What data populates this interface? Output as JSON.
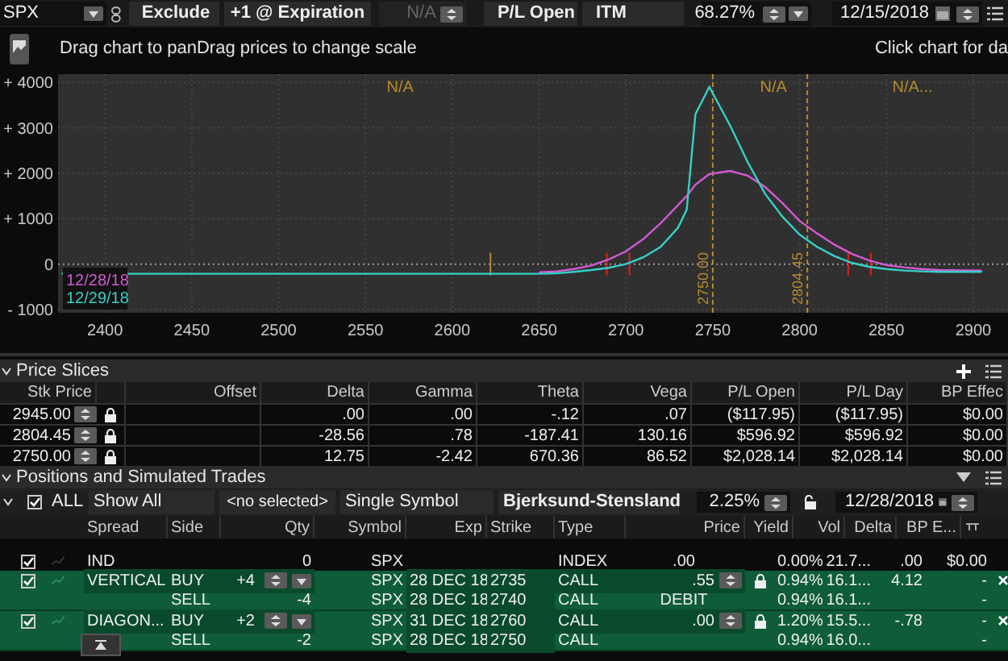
{
  "toolbar": {
    "symbol": "SPX",
    "exclude": "Exclude",
    "step": "+1 @ Expiration",
    "offset_field": "N/A",
    "pl_mode": "P/L Open",
    "moneyness": "ITM",
    "volatility": "68.27%",
    "date": "12/15/2018"
  },
  "hint_bar": {
    "left": "Drag chart to panDrag prices to change scale",
    "right": "Click chart for da"
  },
  "chart": {
    "zone_labels": [
      "N/A",
      "N/A",
      "N/A..."
    ],
    "chart_data": {
      "type": "line",
      "grid": true,
      "xlim": [
        2373,
        2920
      ],
      "ylim": [
        -1070,
        4180
      ],
      "xticks": [
        2400,
        2450,
        2500,
        2550,
        2600,
        2650,
        2700,
        2750,
        2800,
        2850,
        2900
      ],
      "yticks": [
        {
          "value": 4000,
          "label": "+ 4000"
        },
        {
          "value": 3000,
          "label": "+ 3000"
        },
        {
          "value": 2000,
          "label": "+ 2000"
        },
        {
          "value": 1000,
          "label": "+ 1000"
        },
        {
          "value": 0,
          "label": "0"
        },
        {
          "value": -1000,
          "label": "- 1000"
        }
      ],
      "x": [
        2375,
        2650,
        2660,
        2670,
        2680,
        2690,
        2700,
        2710,
        2720,
        2730,
        2735,
        2740,
        2748,
        2760,
        2770,
        2780,
        2790,
        2800,
        2810,
        2820,
        2830,
        2840,
        2850,
        2860,
        2870,
        2880,
        2905
      ],
      "series": [
        {
          "name": "12/28/18",
          "color": "#d25ad2",
          "values": [
            null,
            -180,
            -160,
            -110,
            -30,
            100,
            280,
            550,
            900,
            1300,
            1500,
            1750,
            1980,
            2050,
            1950,
            1700,
            1350,
            950,
            680,
            430,
            230,
            80,
            -20,
            -70,
            -110,
            -130,
            -140
          ]
        },
        {
          "name": "12/29/18",
          "color": "#35d0c8",
          "values": [
            -210,
            -210,
            -200,
            -170,
            -130,
            -80,
            0,
            150,
            380,
            800,
            1200,
            3300,
            3900,
            3050,
            2250,
            1550,
            1050,
            650,
            380,
            180,
            30,
            -60,
            -110,
            -140,
            -160,
            -170,
            -170
          ]
        }
      ],
      "ref_lines": [
        {
          "axis": "y",
          "value": 0,
          "color": "#999999"
        },
        {
          "axis": "x",
          "value": 2750,
          "label": "2750.00",
          "color": "#b88a2a"
        },
        {
          "axis": "x",
          "value": 2804.45,
          "label": "2804.45",
          "color": "#b88a2a"
        }
      ]
    }
  },
  "price_slices": {
    "title": "Price Slices",
    "columns": [
      "Stk Price",
      "Offset",
      "Delta",
      "Gamma",
      "Theta",
      "Vega",
      "P/L Open",
      "P/L Day",
      "BP Effec"
    ],
    "rows": [
      {
        "locked": true,
        "cells": [
          "2945.00",
          "",
          ".00",
          ".00",
          "-.12",
          ".07",
          "($117.95)",
          "($117.95)",
          "$0.00"
        ]
      },
      {
        "locked": true,
        "cells": [
          "2804.45",
          "",
          "-28.56",
          ".78",
          "-187.41",
          "130.16",
          "$596.92",
          "$596.92",
          "$0.00"
        ]
      },
      {
        "locked": true,
        "cells": [
          "2750.00",
          "",
          "12.75",
          "-2.42",
          "670.36",
          "86.52",
          "$2,028.14",
          "$2,028.14",
          "$0.00"
        ]
      }
    ]
  },
  "positions": {
    "title": "Positions and Simulated Trades",
    "filters": {
      "all_checked": true,
      "all": "ALL",
      "show": "Show All",
      "selection": "<no selected>",
      "mode": "Single Symbol",
      "model": "Bjerksund-Stensland",
      "rate": "2.25%",
      "date": "12/28/2018"
    },
    "columns": [
      "Spread",
      "Side",
      "Qty",
      "Symbol",
      "Exp",
      "Strike",
      "Type",
      "Price",
      "Yield",
      "Vol",
      "Delta",
      "BP E..."
    ],
    "rows": [
      {
        "simulated": false,
        "checked": true,
        "spread": "IND",
        "legs": [
          {
            "qty": "0",
            "symbol": "SPX",
            "type": "INDEX",
            "price": ".00",
            "locked": false,
            "yield": "0.00%",
            "vol": "21.7...",
            "delta": ".00",
            "bp": "$0.00"
          }
        ]
      },
      {
        "simulated": true,
        "checked": true,
        "spread": "VERTICAL",
        "legs": [
          {
            "side": "BUY",
            "qty": "+4",
            "symbol": "SPX",
            "exp": "28 DEC 18",
            "strike": "2735",
            "type": "CALL",
            "price": ".55",
            "locked": true,
            "yield": "0.94%",
            "vol": "16.1...",
            "delta": "4.12",
            "bp": "-"
          },
          {
            "side": "SELL",
            "qty": "-4",
            "symbol": "SPX",
            "exp": "28 DEC 18",
            "strike": "2740",
            "type": "CALL",
            "price": "DEBIT",
            "locked": false,
            "yield": "0.94%",
            "vol": "16.1...",
            "bp": "-"
          }
        ]
      },
      {
        "simulated": true,
        "checked": true,
        "spread": "DIAGON...",
        "legs": [
          {
            "side": "BUY",
            "qty": "+2",
            "symbol": "SPX",
            "exp": "31 DEC 18",
            "strike": "2760",
            "type": "CALL",
            "price": ".00",
            "locked": true,
            "yield": "1.20%",
            "vol": "15.5...",
            "delta": "-.78",
            "bp": "-"
          },
          {
            "side": "SELL",
            "qty": "-2",
            "symbol": "SPX",
            "exp": "28 DEC 18",
            "strike": "2750",
            "type": "CALL",
            "locked": false,
            "yield": "0.94%",
            "vol": "16.0...",
            "bp": "-"
          }
        ]
      }
    ]
  }
}
